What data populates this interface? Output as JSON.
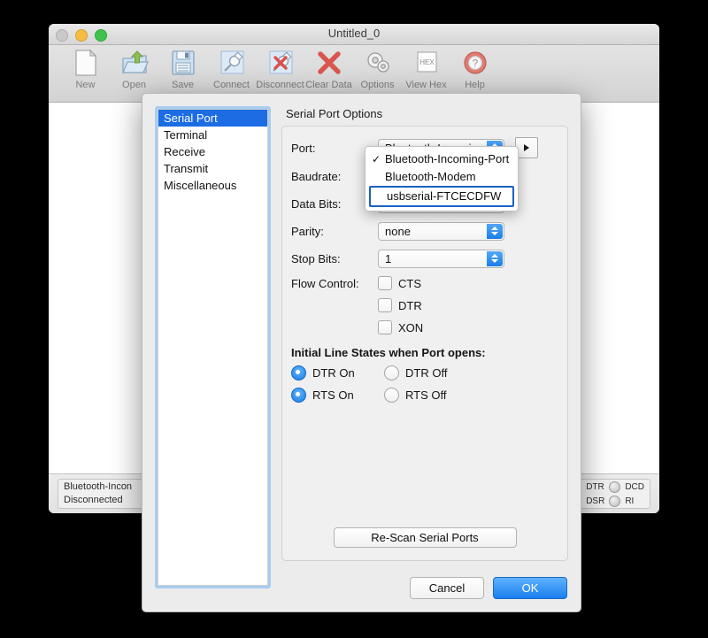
{
  "window": {
    "title": "Untitled_0",
    "traffic_lights": [
      "close",
      "minimize",
      "zoom"
    ]
  },
  "toolbar": {
    "items": [
      {
        "label": "New",
        "icon": "new-document-icon"
      },
      {
        "label": "Open",
        "icon": "open-folder-icon"
      },
      {
        "label": "Save",
        "icon": "floppy-disk-icon"
      },
      {
        "label": "Connect",
        "icon": "plug-connect-icon"
      },
      {
        "label": "Disconnect",
        "icon": "plug-disconnect-icon"
      },
      {
        "label": "Clear Data",
        "icon": "red-x-icon"
      },
      {
        "label": "Options",
        "icon": "gears-icon"
      },
      {
        "label": "View Hex",
        "icon": "hex-page-icon"
      },
      {
        "label": "Help",
        "icon": "life-ring-question-icon"
      }
    ]
  },
  "statusbar": {
    "port_name": "Bluetooth-Incon",
    "connection_state": "Disconnected",
    "signals": [
      {
        "label": "DTR"
      },
      {
        "label": "DCD"
      },
      {
        "label": "DSR"
      },
      {
        "label": "RI"
      }
    ]
  },
  "dialog": {
    "sidebar": {
      "items": [
        {
          "label": "Serial Port",
          "selected": true
        },
        {
          "label": "Terminal",
          "selected": false
        },
        {
          "label": "Receive",
          "selected": false
        },
        {
          "label": "Transmit",
          "selected": false
        },
        {
          "label": "Miscellaneous",
          "selected": false
        }
      ]
    },
    "panel_title": "Serial Port Options",
    "fields": {
      "port": {
        "label": "Port:",
        "value": "Bluetooth-Incoming-..."
      },
      "baudrate": {
        "label": "Baudrate:",
        "value": ""
      },
      "data_bits": {
        "label": "Data Bits:",
        "value": ""
      },
      "parity": {
        "label": "Parity:",
        "value": "none"
      },
      "stop_bits": {
        "label": "Stop Bits:",
        "value": "1"
      },
      "flow_control": {
        "label": "Flow Control:",
        "options": [
          {
            "label": "CTS",
            "checked": false
          },
          {
            "label": "DTR",
            "checked": false
          },
          {
            "label": "XON",
            "checked": false
          }
        ]
      }
    },
    "line_states": {
      "title": "Initial Line States when Port opens:",
      "options": [
        {
          "label": "DTR On",
          "selected": true
        },
        {
          "label": "DTR Off",
          "selected": false
        },
        {
          "label": "RTS On",
          "selected": true
        },
        {
          "label": "RTS Off",
          "selected": false
        }
      ]
    },
    "rescan_label": "Re-Scan Serial Ports",
    "cancel_label": "Cancel",
    "ok_label": "OK"
  },
  "port_menu": {
    "items": [
      {
        "label": "Bluetooth-Incoming-Port",
        "checked": true,
        "focused": false
      },
      {
        "label": "Bluetooth-Modem",
        "checked": false,
        "focused": false
      },
      {
        "label": "usbserial-FTCECDFW",
        "checked": false,
        "focused": true
      }
    ],
    "check_glyph": "✓"
  },
  "colors": {
    "accent_blue": "#1c6ce4",
    "selection_blue": "#1a7ee8",
    "focus_ring": "#a8cdf0",
    "menu_focus": "#1a62c4"
  }
}
